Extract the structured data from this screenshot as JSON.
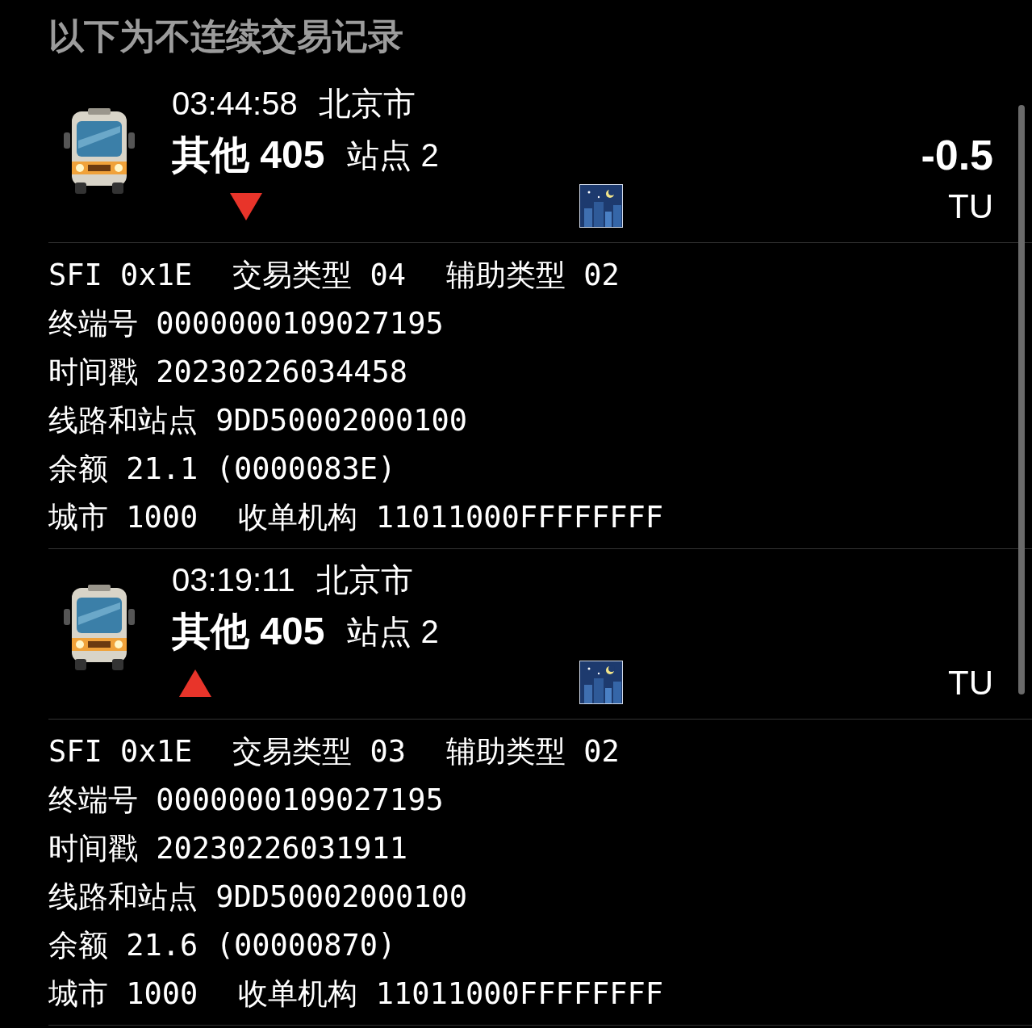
{
  "header": "以下为不连续交易记录",
  "records": [
    {
      "time": "03:44:58",
      "city": "北京市",
      "line": "其他 405",
      "station": "站点 2",
      "down": true,
      "amount": "-0.5",
      "currency": "TU",
      "details": [
        [
          "SFI 0x1E",
          "交易类型 04",
          "辅助类型 02"
        ],
        [
          "终端号 0000000109027195"
        ],
        [
          "时间戳 20230226034458"
        ],
        [
          "线路和站点 9DD50002000100"
        ],
        [
          "余额 21.1 (0000083E)"
        ],
        [
          "城市 1000",
          "收单机构 11011000FFFFFFFF"
        ]
      ]
    },
    {
      "time": "03:19:11",
      "city": "北京市",
      "line": "其他 405",
      "station": "站点 2",
      "down": false,
      "currency": "TU",
      "details": [
        [
          "SFI 0x1E",
          "交易类型 03",
          "辅助类型 02"
        ],
        [
          "终端号 0000000109027195"
        ],
        [
          "时间戳 20230226031911"
        ],
        [
          "线路和站点 9DD50002000100"
        ],
        [
          "余额 21.6 (00000870)"
        ],
        [
          "城市 1000",
          "收单机构 11011000FFFFFFFF"
        ]
      ]
    }
  ]
}
